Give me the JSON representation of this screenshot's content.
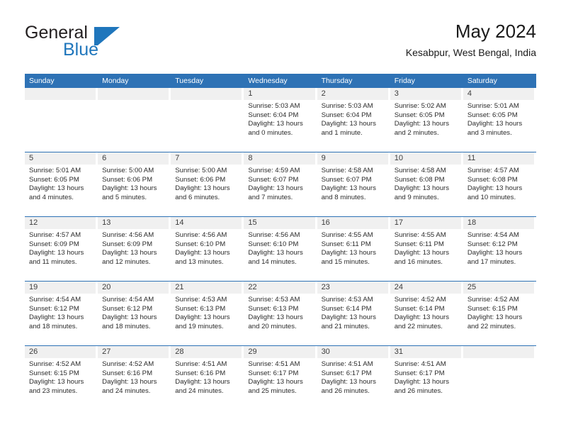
{
  "brand": {
    "name_part1": "General",
    "name_part2": "Blue",
    "mark_icon": "triangle-flag-icon",
    "accent_color": "#1f76bc"
  },
  "header": {
    "title": "May 2024",
    "subtitle": "Kesabpur, West Bengal, India"
  },
  "theme": {
    "header_blue": "#2e72b5",
    "daynum_gray": "#f0f0f0",
    "text_color": "#2b2b2b"
  },
  "calendar": {
    "weekdays": [
      "Sunday",
      "Monday",
      "Tuesday",
      "Wednesday",
      "Thursday",
      "Friday",
      "Saturday"
    ],
    "weeks": [
      [
        {
          "day": "",
          "lines": []
        },
        {
          "day": "",
          "lines": []
        },
        {
          "day": "",
          "lines": []
        },
        {
          "day": "1",
          "lines": [
            "Sunrise: 5:03 AM",
            "Sunset: 6:04 PM",
            "Daylight: 13 hours",
            "and 0 minutes."
          ]
        },
        {
          "day": "2",
          "lines": [
            "Sunrise: 5:03 AM",
            "Sunset: 6:04 PM",
            "Daylight: 13 hours",
            "and 1 minute."
          ]
        },
        {
          "day": "3",
          "lines": [
            "Sunrise: 5:02 AM",
            "Sunset: 6:05 PM",
            "Daylight: 13 hours",
            "and 2 minutes."
          ]
        },
        {
          "day": "4",
          "lines": [
            "Sunrise: 5:01 AM",
            "Sunset: 6:05 PM",
            "Daylight: 13 hours",
            "and 3 minutes."
          ]
        }
      ],
      [
        {
          "day": "5",
          "lines": [
            "Sunrise: 5:01 AM",
            "Sunset: 6:05 PM",
            "Daylight: 13 hours",
            "and 4 minutes."
          ]
        },
        {
          "day": "6",
          "lines": [
            "Sunrise: 5:00 AM",
            "Sunset: 6:06 PM",
            "Daylight: 13 hours",
            "and 5 minutes."
          ]
        },
        {
          "day": "7",
          "lines": [
            "Sunrise: 5:00 AM",
            "Sunset: 6:06 PM",
            "Daylight: 13 hours",
            "and 6 minutes."
          ]
        },
        {
          "day": "8",
          "lines": [
            "Sunrise: 4:59 AM",
            "Sunset: 6:07 PM",
            "Daylight: 13 hours",
            "and 7 minutes."
          ]
        },
        {
          "day": "9",
          "lines": [
            "Sunrise: 4:58 AM",
            "Sunset: 6:07 PM",
            "Daylight: 13 hours",
            "and 8 minutes."
          ]
        },
        {
          "day": "10",
          "lines": [
            "Sunrise: 4:58 AM",
            "Sunset: 6:08 PM",
            "Daylight: 13 hours",
            "and 9 minutes."
          ]
        },
        {
          "day": "11",
          "lines": [
            "Sunrise: 4:57 AM",
            "Sunset: 6:08 PM",
            "Daylight: 13 hours",
            "and 10 minutes."
          ]
        }
      ],
      [
        {
          "day": "12",
          "lines": [
            "Sunrise: 4:57 AM",
            "Sunset: 6:09 PM",
            "Daylight: 13 hours",
            "and 11 minutes."
          ]
        },
        {
          "day": "13",
          "lines": [
            "Sunrise: 4:56 AM",
            "Sunset: 6:09 PM",
            "Daylight: 13 hours",
            "and 12 minutes."
          ]
        },
        {
          "day": "14",
          "lines": [
            "Sunrise: 4:56 AM",
            "Sunset: 6:10 PM",
            "Daylight: 13 hours",
            "and 13 minutes."
          ]
        },
        {
          "day": "15",
          "lines": [
            "Sunrise: 4:56 AM",
            "Sunset: 6:10 PM",
            "Daylight: 13 hours",
            "and 14 minutes."
          ]
        },
        {
          "day": "16",
          "lines": [
            "Sunrise: 4:55 AM",
            "Sunset: 6:11 PM",
            "Daylight: 13 hours",
            "and 15 minutes."
          ]
        },
        {
          "day": "17",
          "lines": [
            "Sunrise: 4:55 AM",
            "Sunset: 6:11 PM",
            "Daylight: 13 hours",
            "and 16 minutes."
          ]
        },
        {
          "day": "18",
          "lines": [
            "Sunrise: 4:54 AM",
            "Sunset: 6:12 PM",
            "Daylight: 13 hours",
            "and 17 minutes."
          ]
        }
      ],
      [
        {
          "day": "19",
          "lines": [
            "Sunrise: 4:54 AM",
            "Sunset: 6:12 PM",
            "Daylight: 13 hours",
            "and 18 minutes."
          ]
        },
        {
          "day": "20",
          "lines": [
            "Sunrise: 4:54 AM",
            "Sunset: 6:12 PM",
            "Daylight: 13 hours",
            "and 18 minutes."
          ]
        },
        {
          "day": "21",
          "lines": [
            "Sunrise: 4:53 AM",
            "Sunset: 6:13 PM",
            "Daylight: 13 hours",
            "and 19 minutes."
          ]
        },
        {
          "day": "22",
          "lines": [
            "Sunrise: 4:53 AM",
            "Sunset: 6:13 PM",
            "Daylight: 13 hours",
            "and 20 minutes."
          ]
        },
        {
          "day": "23",
          "lines": [
            "Sunrise: 4:53 AM",
            "Sunset: 6:14 PM",
            "Daylight: 13 hours",
            "and 21 minutes."
          ]
        },
        {
          "day": "24",
          "lines": [
            "Sunrise: 4:52 AM",
            "Sunset: 6:14 PM",
            "Daylight: 13 hours",
            "and 22 minutes."
          ]
        },
        {
          "day": "25",
          "lines": [
            "Sunrise: 4:52 AM",
            "Sunset: 6:15 PM",
            "Daylight: 13 hours",
            "and 22 minutes."
          ]
        }
      ],
      [
        {
          "day": "26",
          "lines": [
            "Sunrise: 4:52 AM",
            "Sunset: 6:15 PM",
            "Daylight: 13 hours",
            "and 23 minutes."
          ]
        },
        {
          "day": "27",
          "lines": [
            "Sunrise: 4:52 AM",
            "Sunset: 6:16 PM",
            "Daylight: 13 hours",
            "and 24 minutes."
          ]
        },
        {
          "day": "28",
          "lines": [
            "Sunrise: 4:51 AM",
            "Sunset: 6:16 PM",
            "Daylight: 13 hours",
            "and 24 minutes."
          ]
        },
        {
          "day": "29",
          "lines": [
            "Sunrise: 4:51 AM",
            "Sunset: 6:17 PM",
            "Daylight: 13 hours",
            "and 25 minutes."
          ]
        },
        {
          "day": "30",
          "lines": [
            "Sunrise: 4:51 AM",
            "Sunset: 6:17 PM",
            "Daylight: 13 hours",
            "and 26 minutes."
          ]
        },
        {
          "day": "31",
          "lines": [
            "Sunrise: 4:51 AM",
            "Sunset: 6:17 PM",
            "Daylight: 13 hours",
            "and 26 minutes."
          ]
        },
        {
          "day": "",
          "lines": []
        }
      ]
    ]
  }
}
